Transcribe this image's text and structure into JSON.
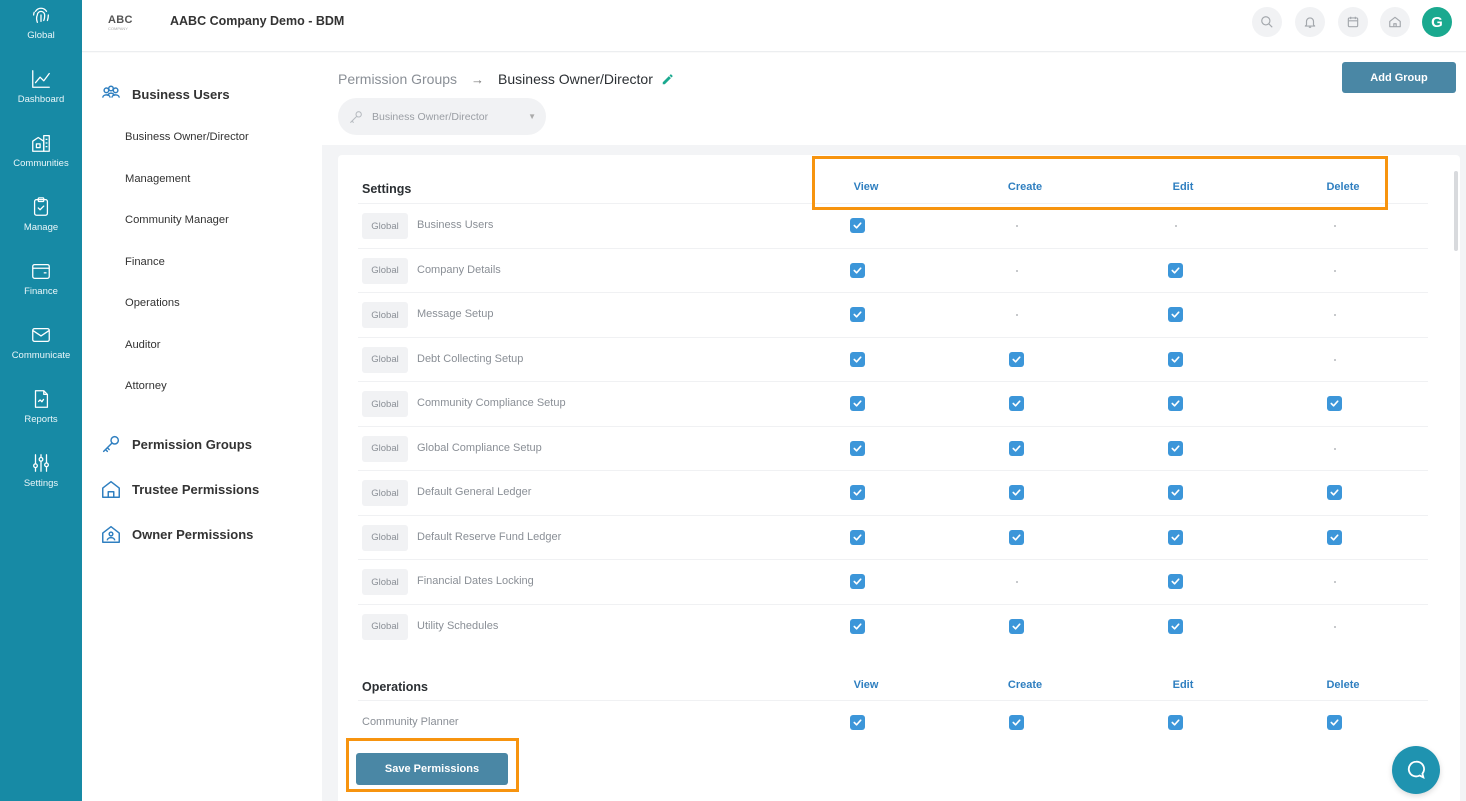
{
  "nav": {
    "items": [
      {
        "label": "Global",
        "icon": "fingerprint-icon"
      },
      {
        "label": "Dashboard",
        "icon": "line-chart-icon"
      },
      {
        "label": "Communities",
        "icon": "buildings-icon"
      },
      {
        "label": "Manage",
        "icon": "clipboard-check-icon"
      },
      {
        "label": "Finance",
        "icon": "wallet-icon"
      },
      {
        "label": "Communicate",
        "icon": "mail-icon"
      },
      {
        "label": "Reports",
        "icon": "report-icon"
      },
      {
        "label": "Settings",
        "icon": "sliders-icon"
      }
    ]
  },
  "header": {
    "logo_text": "ABC",
    "logo_sub": "COMPANY",
    "company": "AABC Company Demo - BDM",
    "avatar_initial": "G"
  },
  "sidebar": {
    "business_users": "Business Users",
    "sub_items": [
      "Business Owner/Director",
      "Management",
      "Community Manager",
      "Finance",
      "Operations",
      "Auditor",
      "Attorney"
    ],
    "permission_groups": "Permission Groups",
    "trustee_permissions": "Trustee Permissions",
    "owner_permissions": "Owner Permissions"
  },
  "main": {
    "breadcrumb_parent": "Permission Groups",
    "breadcrumb_arrow": "→",
    "breadcrumb_current": "Business Owner/Director",
    "add_group": "Add Group",
    "select_value": "Business Owner/Director",
    "save_permissions": "Save Permissions"
  },
  "columns": [
    "View",
    "Create",
    "Edit",
    "Delete"
  ],
  "sections": [
    {
      "title": "Settings",
      "rows": [
        {
          "badge": "Global",
          "label": "Business Users",
          "perms": [
            true,
            false,
            false,
            false
          ]
        },
        {
          "badge": "Global",
          "label": "Company Details",
          "perms": [
            true,
            false,
            true,
            false
          ]
        },
        {
          "badge": "Global",
          "label": "Message Setup",
          "perms": [
            true,
            false,
            true,
            false
          ]
        },
        {
          "badge": "Global",
          "label": "Debt Collecting Setup",
          "perms": [
            true,
            true,
            true,
            false
          ]
        },
        {
          "badge": "Global",
          "label": "Community Compliance Setup",
          "perms": [
            true,
            true,
            true,
            true
          ]
        },
        {
          "badge": "Global",
          "label": "Global Compliance Setup",
          "perms": [
            true,
            true,
            true,
            false
          ]
        },
        {
          "badge": "Global",
          "label": "Default General Ledger",
          "perms": [
            true,
            true,
            true,
            true
          ]
        },
        {
          "badge": "Global",
          "label": "Default Reserve Fund Ledger",
          "perms": [
            true,
            true,
            true,
            true
          ]
        },
        {
          "badge": "Global",
          "label": "Financial Dates Locking",
          "perms": [
            true,
            false,
            true,
            false
          ]
        },
        {
          "badge": "Global",
          "label": "Utility Schedules",
          "perms": [
            true,
            true,
            true,
            false
          ]
        }
      ]
    },
    {
      "title": "Operations",
      "rows": [
        {
          "badge": "",
          "label": "Community Planner",
          "perms": [
            true,
            true,
            true,
            true
          ]
        }
      ]
    }
  ],
  "colors": {
    "rail": "#178aa5",
    "accent": "#3c96d9",
    "button": "#4a87a5",
    "highlight": "#f7940f",
    "avatar": "#1aa98f"
  }
}
